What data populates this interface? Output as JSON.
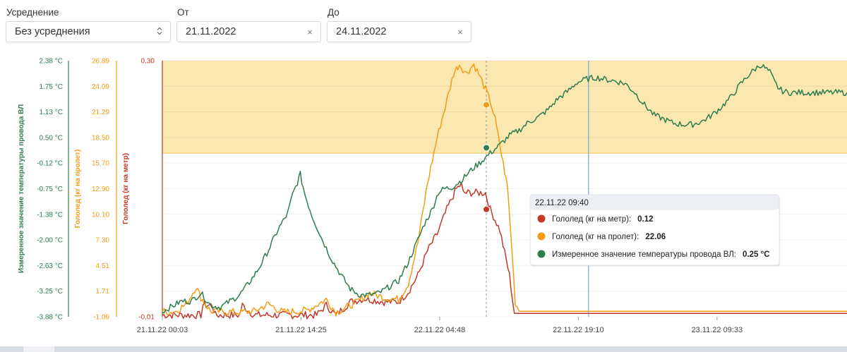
{
  "filters": {
    "averaging": {
      "label": "Усреднение",
      "value": "Без усреднения"
    },
    "from": {
      "label": "От",
      "value": "21.11.2022"
    },
    "to": {
      "label": "До",
      "value": "24.11.2022"
    },
    "clear_glyph": "×"
  },
  "chart_data": {
    "type": "line",
    "x_ticks": [
      "21.11.22 00:03",
      "21.11.22 14:25",
      "22.11.22 04:48",
      "22.11.22 19:10",
      "23.11.22 09:33"
    ],
    "axes": [
      {
        "id": "temp",
        "label": "Измеренное значение температуры провода ВЛ",
        "color": "#2e7d4f",
        "unit": "°C",
        "ticks": [
          "2.38 °C",
          "1.75 °C",
          "1.13 °C",
          "0.50 °C",
          "-0.12 °C",
          "-0.75 °C",
          "-1.38 °C",
          "-2.00 °C",
          "-2.63 °C",
          "-3.25 °C",
          "-3.88 °C"
        ],
        "range": [
          -3.88,
          2.38
        ]
      },
      {
        "id": "span",
        "label": "Гололед (кг на пролет)",
        "color": "#f39c12",
        "unit": "",
        "ticks": [
          "26.89",
          "24.09",
          "21.29",
          "18.50",
          "15.70",
          "12.90",
          "10.10",
          "7.30",
          "4.51",
          "1.71",
          "-1.09"
        ],
        "range": [
          -1.09,
          26.89
        ]
      },
      {
        "id": "meter",
        "label": "Гололед (кг на метр)",
        "color": "#c0392b",
        "unit": "",
        "ticks": [
          "0.30",
          "-0.01"
        ],
        "range": [
          -0.01,
          0.3
        ]
      }
    ],
    "threshold_band": {
      "axis": "meter",
      "from": 0.188,
      "to": 0.3,
      "color": "#fbe7b0"
    },
    "x_hours_range": [
      0,
      71
    ],
    "series": [
      {
        "name": "Гололед (кг на метр)",
        "axis": "meter",
        "color": "#c0392b",
        "points": [
          [
            0,
            -0.008
          ],
          [
            4,
            -0.008
          ],
          [
            4.2,
            0.004
          ],
          [
            5.2,
            0.004
          ],
          [
            5.5,
            -0.008
          ],
          [
            8,
            -0.008
          ],
          [
            8.3,
            0.004
          ],
          [
            9.5,
            -0.008
          ],
          [
            16,
            -0.008
          ],
          [
            17,
            0.004
          ],
          [
            18,
            -0.008
          ],
          [
            19.5,
            0.008
          ],
          [
            21,
            0.012
          ],
          [
            23,
            0.008
          ],
          [
            24.5,
            0.008
          ],
          [
            25.5,
            0.02
          ],
          [
            26.5,
            0.04
          ],
          [
            27.5,
            0.07
          ],
          [
            28.5,
            0.09
          ],
          [
            29.5,
            0.12
          ],
          [
            30.5,
            0.145
          ],
          [
            31,
            0.15
          ],
          [
            31.2,
            0.14
          ],
          [
            33.5,
            0.14
          ],
          [
            34,
            0.12
          ],
          [
            35,
            0.095
          ],
          [
            36,
            0.04
          ],
          [
            36.5,
            -0.006
          ],
          [
            71,
            -0.006
          ]
        ]
      },
      {
        "name": "Гололед (кг на пролет)",
        "axis": "span",
        "color": "#f39c12",
        "points": [
          [
            0,
            -0.5
          ],
          [
            1.2,
            -0.6
          ],
          [
            2.5,
            0.3
          ],
          [
            3.5,
            2.2
          ],
          [
            4,
            1.0
          ],
          [
            5,
            -0.5
          ],
          [
            8,
            -0.6
          ],
          [
            9.5,
            -0.5
          ],
          [
            11,
            0.3
          ],
          [
            12.5,
            -0.6
          ],
          [
            15,
            -0.4
          ],
          [
            17,
            0.8
          ],
          [
            18,
            -0.6
          ],
          [
            20,
            0.4
          ],
          [
            21.5,
            1.5
          ],
          [
            23,
            1.0
          ],
          [
            24.5,
            0.8
          ],
          [
            25.5,
            2.5
          ],
          [
            26.5,
            7.0
          ],
          [
            27.5,
            13.5
          ],
          [
            28.5,
            18.5
          ],
          [
            29.5,
            22.5
          ],
          [
            30.2,
            25.5
          ],
          [
            30.8,
            26.5
          ],
          [
            31.5,
            25.5
          ],
          [
            32.3,
            26.5
          ],
          [
            33,
            25.0
          ],
          [
            34,
            22.5
          ],
          [
            34.5,
            20.5
          ],
          [
            35.2,
            16.5
          ],
          [
            35.8,
            13.0
          ],
          [
            36.2,
            7.0
          ],
          [
            36.6,
            0.5
          ],
          [
            37,
            -0.5
          ],
          [
            71,
            -0.5
          ]
        ]
      },
      {
        "name": "Измеренное значение температуры провода ВЛ",
        "axis": "temp",
        "color": "#2e7d4f",
        "points": [
          [
            0,
            -3.75
          ],
          [
            2,
            -3.5
          ],
          [
            3,
            -3.5
          ],
          [
            4,
            -3.3
          ],
          [
            5,
            -3.6
          ],
          [
            6,
            -3.65
          ],
          [
            7,
            -3.5
          ],
          [
            8,
            -3.35
          ],
          [
            9,
            -3.05
          ],
          [
            10,
            -2.7
          ],
          [
            11,
            -2.25
          ],
          [
            12,
            -1.75
          ],
          [
            13,
            -1.35
          ],
          [
            13.5,
            -0.9
          ],
          [
            14,
            -0.6
          ],
          [
            14.3,
            -0.4
          ],
          [
            14.8,
            -0.9
          ],
          [
            15.5,
            -1.4
          ],
          [
            16.5,
            -1.95
          ],
          [
            17.5,
            -2.45
          ],
          [
            18.5,
            -2.85
          ],
          [
            19.5,
            -3.2
          ],
          [
            20.5,
            -3.35
          ],
          [
            21.5,
            -3.35
          ],
          [
            22.5,
            -3.3
          ],
          [
            23.5,
            -3.15
          ],
          [
            24.5,
            -3.0
          ],
          [
            25.5,
            -2.55
          ],
          [
            26.5,
            -2.0
          ],
          [
            27.2,
            -1.6
          ],
          [
            28,
            -1.25
          ],
          [
            28.6,
            -0.85
          ],
          [
            29.2,
            -0.75
          ],
          [
            30,
            -0.72
          ],
          [
            31,
            -0.55
          ],
          [
            32,
            -0.3
          ],
          [
            33,
            -0.1
          ],
          [
            34,
            0.12
          ],
          [
            35,
            0.32
          ],
          [
            36,
            0.55
          ],
          [
            37,
            0.68
          ],
          [
            38,
            0.88
          ],
          [
            39,
            1.0
          ],
          [
            40,
            1.18
          ],
          [
            41,
            1.45
          ],
          [
            42,
            1.62
          ],
          [
            43,
            1.85
          ],
          [
            44,
            1.93
          ],
          [
            45,
            1.97
          ],
          [
            46,
            1.92
          ],
          [
            47,
            1.88
          ],
          [
            48,
            1.82
          ],
          [
            49,
            1.6
          ],
          [
            50,
            1.3
          ],
          [
            51,
            1.05
          ],
          [
            52,
            0.95
          ],
          [
            53,
            0.85
          ],
          [
            54,
            0.82
          ],
          [
            55,
            0.82
          ],
          [
            56,
            0.9
          ],
          [
            57,
            1.05
          ],
          [
            58,
            1.25
          ],
          [
            59,
            1.5
          ],
          [
            60,
            1.82
          ],
          [
            61,
            2.08
          ],
          [
            62,
            2.28
          ],
          [
            62.5,
            2.2
          ],
          [
            63,
            2.1
          ],
          [
            63.5,
            1.85
          ],
          [
            64,
            1.68
          ],
          [
            64.5,
            1.62
          ],
          [
            65,
            1.6
          ],
          [
            71,
            1.6
          ]
        ]
      }
    ],
    "crosshair": {
      "x_hours": 33.6
    },
    "cursor_line": {
      "x_hours": 44.2
    },
    "tooltip": {
      "title": "22.11.22 09:40",
      "rows": [
        {
          "label": "Гололед (кг на метр):",
          "value": "0.12",
          "color": "#c0392b"
        },
        {
          "label": "Гололед (кг на пролет):",
          "value": "22.06",
          "color": "#f39c12"
        },
        {
          "label": "Измеренное значение температуры провода ВЛ:",
          "value": "0.25 °C",
          "color": "#2e7d4f"
        }
      ]
    }
  }
}
